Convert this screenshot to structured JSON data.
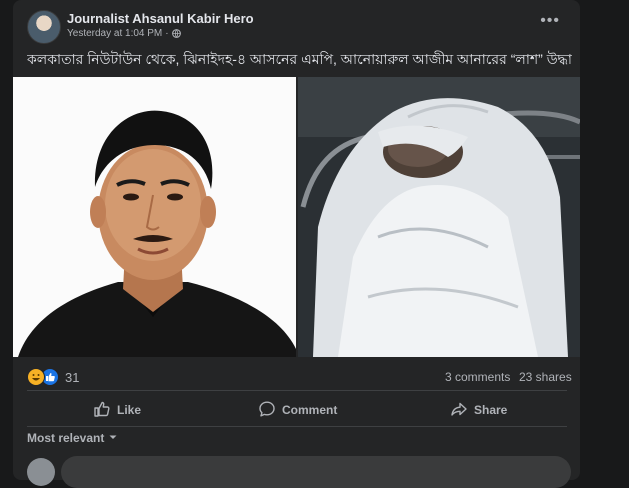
{
  "post": {
    "author": "Journalist Ahsanul Kabir Hero",
    "time": "Yesterday at 1:04 PM",
    "separator": "·",
    "more": "•••",
    "caption": "কলকাতার নিউটাউন থেকে, ঝিনাইদহ-৪ আসনের এমপি, আনোয়ারুল আজীম আনারের “লাশ” উদ্ধার।"
  },
  "stats": {
    "reaction_count": "31",
    "comments": "3 comments",
    "shares": "23 shares"
  },
  "actions": {
    "like": "Like",
    "comment": "Comment",
    "share": "Share"
  },
  "comments": {
    "sort_label": "Most relevant"
  },
  "colors": {
    "background": "#18191a",
    "card": "#242526",
    "text_primary": "#e4e6eb",
    "text_secondary": "#b0b3b8",
    "like_blue": "#1b74e4",
    "haha_yellow": "#f7b125"
  },
  "icons": {
    "globe": "globe-icon",
    "more": "more-options-icon",
    "like": "thumbs-up-icon",
    "comment": "speech-bubble-icon",
    "share": "share-arrow-icon",
    "sort": "chevron-down-icon"
  }
}
